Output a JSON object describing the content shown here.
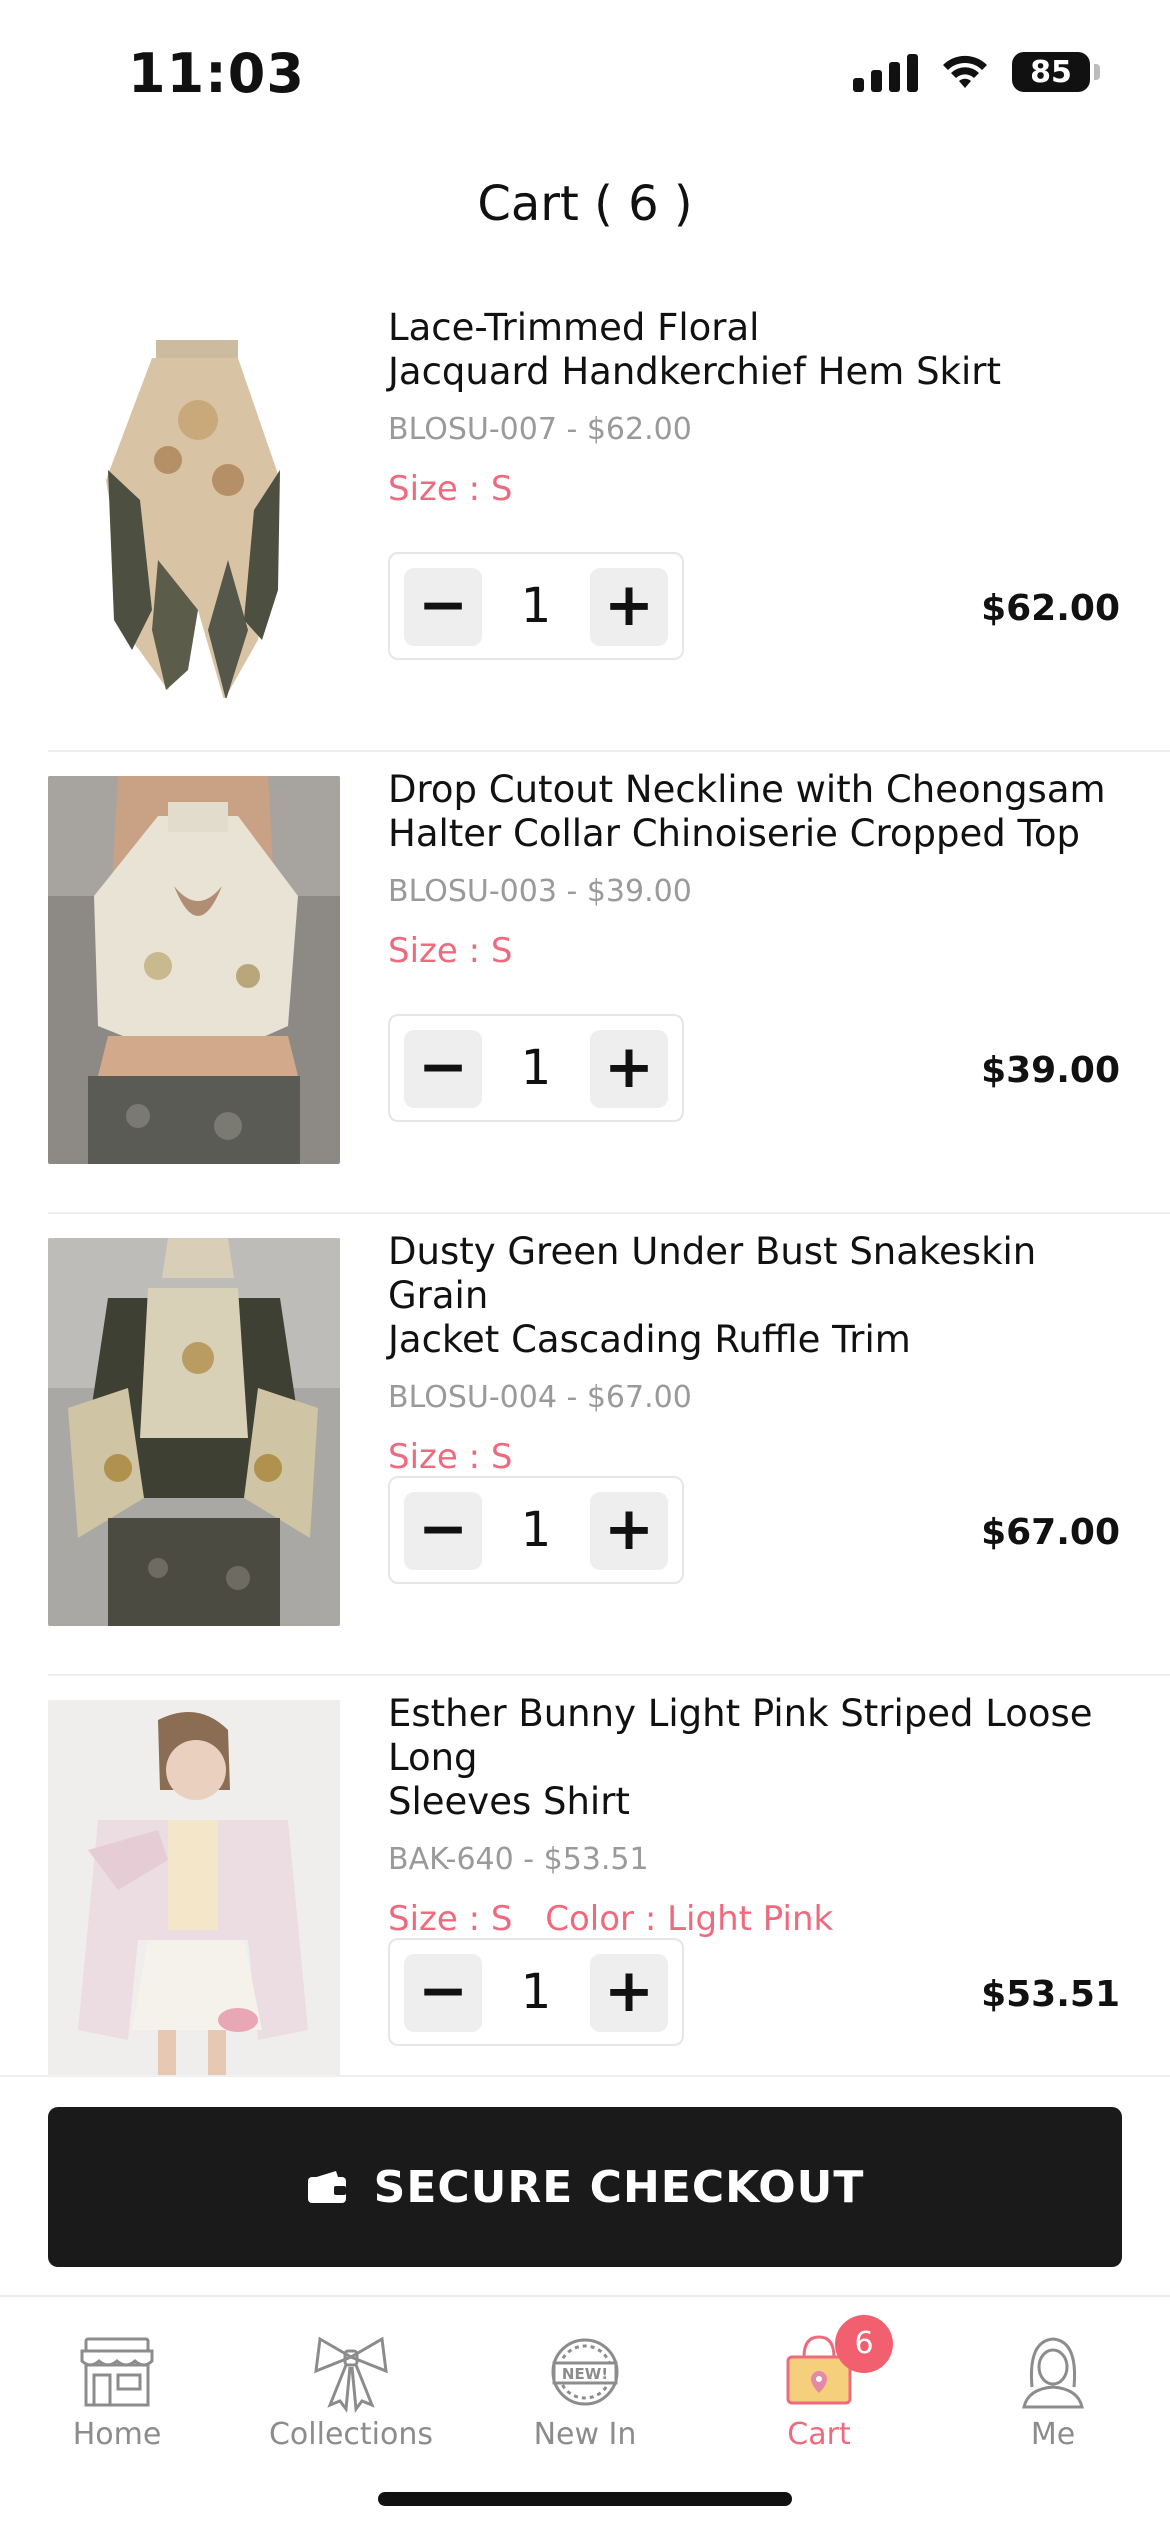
{
  "status_bar": {
    "time": "11:03",
    "battery": "85"
  },
  "header": {
    "title": "Cart ( 6 )"
  },
  "cart_items": [
    {
      "name_line1": "Lace-Trimmed Floral",
      "name_line2": "Jacquard Handkerchief Hem Skirt",
      "sku": "BLOSU-007 - $62.00",
      "size": "Size : S",
      "color": "",
      "quantity": "1",
      "price": "$62.00"
    },
    {
      "name_line1": "Drop Cutout Neckline with Cheongsam",
      "name_line2": "Halter Collar Chinoiserie Cropped Top",
      "sku": "BLOSU-003 - $39.00",
      "size": "Size : S",
      "color": "",
      "quantity": "1",
      "price": "$39.00"
    },
    {
      "name_line1": "Dusty Green Under Bust Snakeskin Grain",
      "name_line2": "Jacket Cascading Ruffle Trim",
      "sku": "BLOSU-004 - $67.00",
      "size": "Size : S",
      "color": "",
      "quantity": "1",
      "price": "$67.00"
    },
    {
      "name_line1": "Esther Bunny Light Pink Striped Loose Long",
      "name_line2": "Sleeves Shirt",
      "sku": "BAK-640 - $53.51",
      "size": "Size : S",
      "color": "Color : Light Pink",
      "quantity": "1",
      "price": "$53.51"
    }
  ],
  "controls": {
    "minus": "−",
    "plus": "+"
  },
  "checkout": {
    "label": "SECURE CHECKOUT",
    "icon": "wallet-icon"
  },
  "tabbar": {
    "tabs": [
      {
        "label": "Home",
        "icon": "storefront-icon"
      },
      {
        "label": "Collections",
        "icon": "bow-icon"
      },
      {
        "label": "New In",
        "icon": "new-badge-icon"
      },
      {
        "label": "Cart",
        "icon": "shopping-bag-icon",
        "badge": "6",
        "active": true
      },
      {
        "label": "Me",
        "icon": "user-avatar-icon"
      }
    ]
  },
  "colors": {
    "accent": "#ee6b7e",
    "badge": "#f2606f",
    "checkout_bg": "#1a1a1a",
    "muted": "#9a9a9a"
  }
}
